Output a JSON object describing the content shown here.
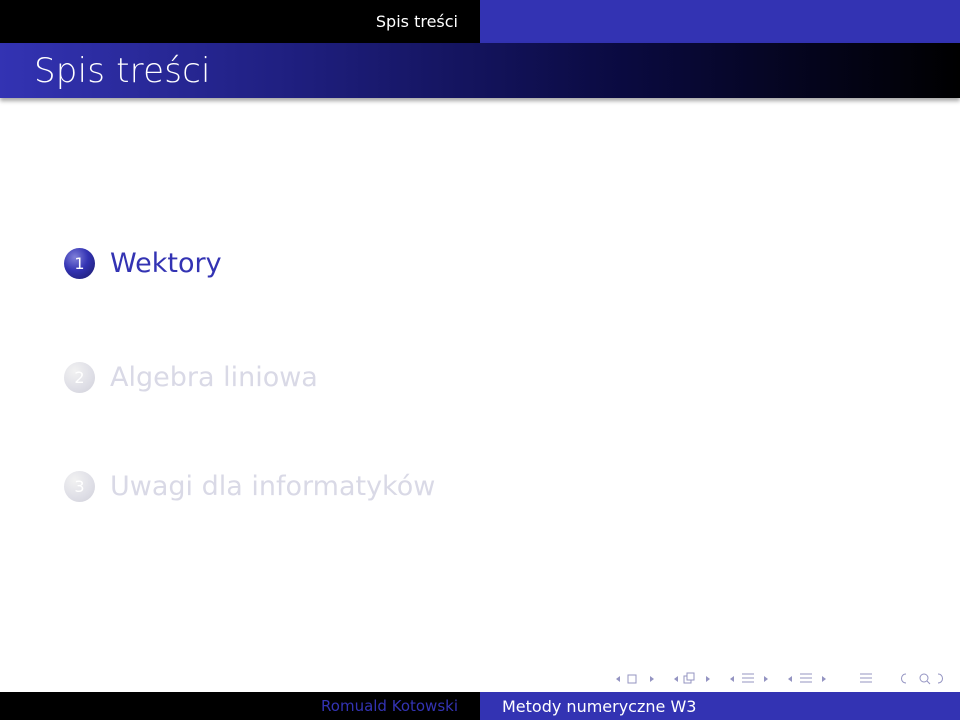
{
  "header": {
    "section": "Spis treści"
  },
  "frame": {
    "title": "Spis treści"
  },
  "toc": [
    {
      "number": "1",
      "label": "Wektory",
      "active": true
    },
    {
      "number": "2",
      "label": "Algebra liniowa",
      "active": false
    },
    {
      "number": "3",
      "label": "Uwagi dla informatyków",
      "active": false
    }
  ],
  "navigation": {
    "icons": [
      "frame-nav-icon",
      "subsection-nav-icon",
      "section-nav-icon",
      "document-nav-icon",
      "appendix-icon",
      "search-icon"
    ]
  },
  "footer": {
    "author": "Romuald Kotowski",
    "title": "Metody numeryczne W3"
  },
  "colors": {
    "accent": "#3333b3",
    "dark": "#000000",
    "inactive": "#d9d9e6"
  }
}
